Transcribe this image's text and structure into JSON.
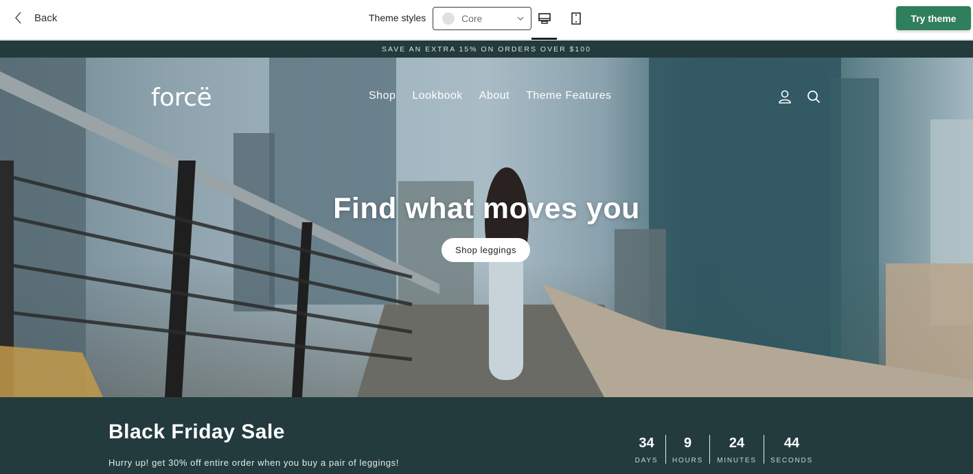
{
  "topbar": {
    "back_label": "Back",
    "theme_styles_label": "Theme styles",
    "theme_select_value": "Core",
    "try_theme_label": "Try theme",
    "active_device": "desktop",
    "accent_color": "#2f7e5c"
  },
  "announcement": {
    "text": "SAVE AN EXTRA 15% ON ORDERS OVER $100"
  },
  "header": {
    "logo": "forcë",
    "nav": [
      {
        "label": "Shop"
      },
      {
        "label": "Lookbook"
      },
      {
        "label": "About"
      },
      {
        "label": "Theme Features"
      }
    ],
    "icons": [
      "account-icon",
      "search-icon"
    ]
  },
  "hero": {
    "title": "Find what moves you",
    "button_label": "Shop leggings"
  },
  "sale": {
    "title": "Black Friday Sale",
    "subtitle": "Hurry up! get 30% off entire order when you buy a pair of leggings!",
    "countdown": [
      {
        "value": "34",
        "label": "DAYS"
      },
      {
        "value": "9",
        "label": "HOURS"
      },
      {
        "value": "24",
        "label": "MINUTES"
      },
      {
        "value": "44",
        "label": "SECONDS"
      }
    ]
  }
}
